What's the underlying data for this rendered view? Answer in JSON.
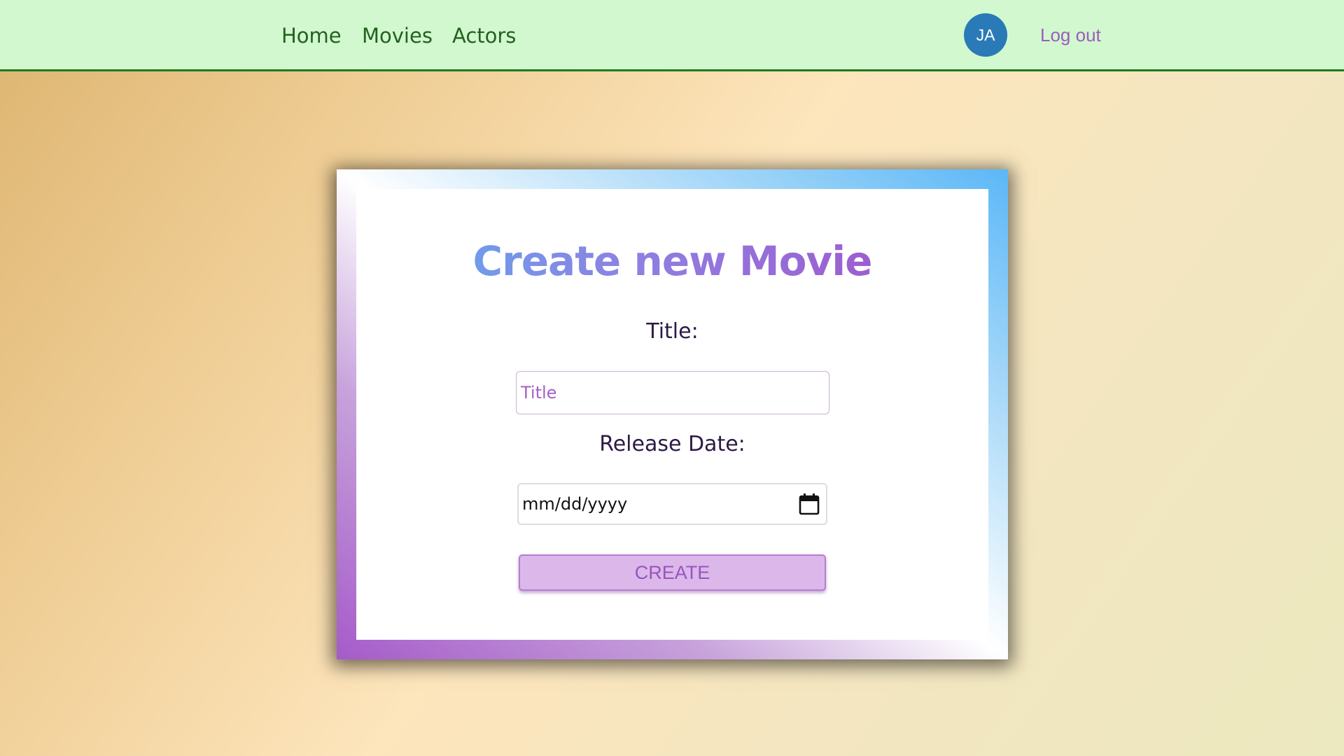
{
  "nav": {
    "home": "Home",
    "movies": "Movies",
    "actors": "Actors",
    "avatar_initials": "JA",
    "logout": "Log out"
  },
  "form": {
    "heading": "Create new Movie",
    "title_label": "Title:",
    "title_placeholder": "Title",
    "title_value": "",
    "date_label": "Release Date:",
    "date_placeholder": "mm/dd/yyyy",
    "submit_label": "CREATE"
  },
  "icons": {
    "calendar": "calendar-icon"
  },
  "colors": {
    "navbar_bg": "#d2f8cf",
    "navbar_border": "#1f7a1f",
    "nav_link": "#23621f",
    "avatar_bg": "#2a7ab7",
    "logout": "#9e5cbf",
    "button_bg": "#dcb7ea",
    "button_text": "#9456bd",
    "heading_gradient_start": "#5aaef0",
    "heading_gradient_end": "#a24ec6"
  }
}
